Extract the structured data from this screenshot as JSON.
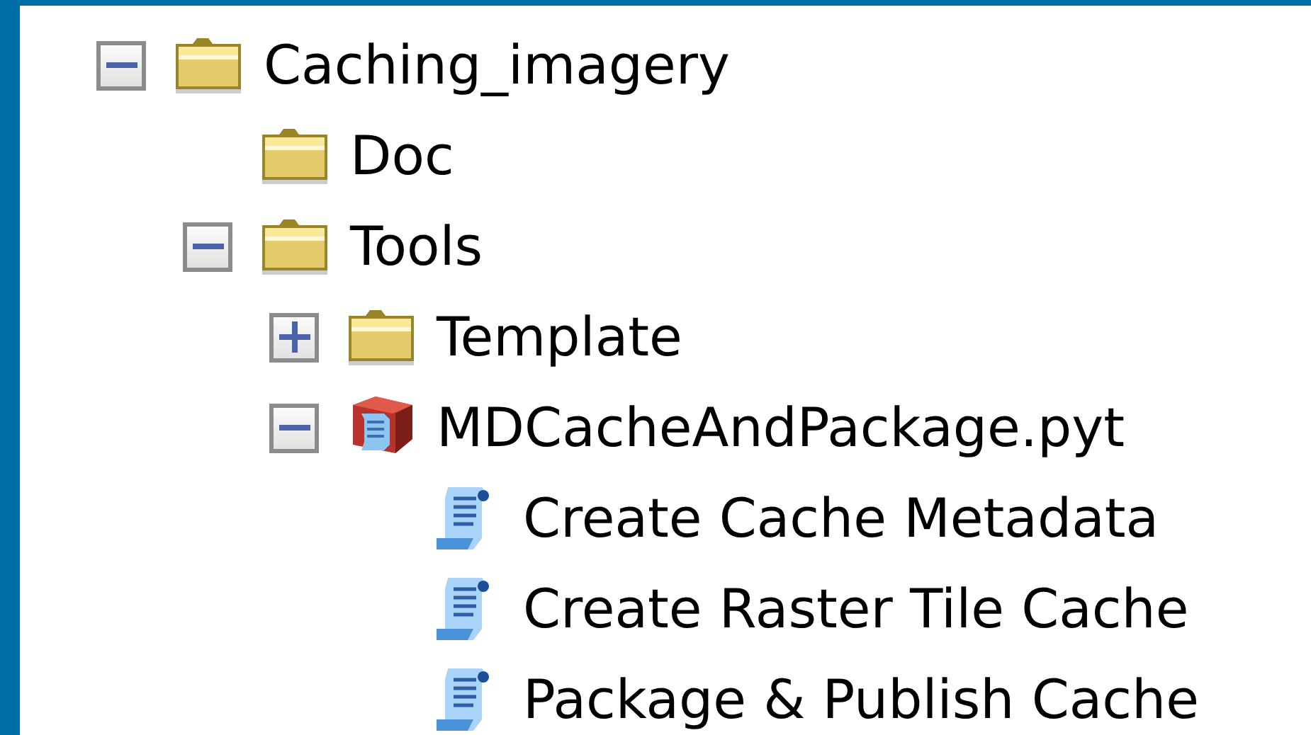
{
  "tree": [
    {
      "kind": "folder",
      "label": "Caching_imagery",
      "expanded": true,
      "children": [
        {
          "kind": "folder",
          "label": "Doc"
        },
        {
          "kind": "folder",
          "label": "Tools",
          "expanded": true,
          "children": [
            {
              "kind": "folder",
              "label": "Template",
              "expanded": false
            },
            {
              "kind": "toolbox",
              "label": "MDCacheAndPackage.pyt",
              "expanded": true,
              "children": [
                {
                  "kind": "script",
                  "label": "Create Cache Metadata"
                },
                {
                  "kind": "script",
                  "label": "Create Raster Tile Cache"
                },
                {
                  "kind": "script",
                  "label": "Package & Publish Cache"
                }
              ]
            }
          ]
        }
      ]
    }
  ]
}
